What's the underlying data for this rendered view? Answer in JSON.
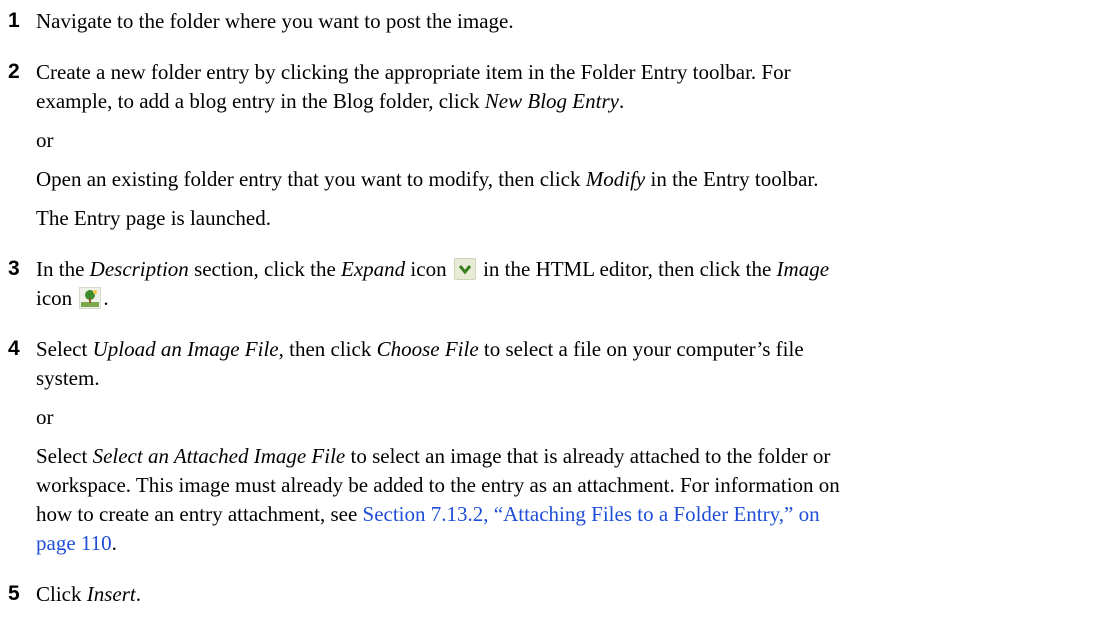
{
  "steps": [
    {
      "number": "1",
      "text": "Navigate to the folder where you want to post the image."
    },
    {
      "number": "2",
      "text_a": "Create a new folder entry by clicking the appropriate item in the Folder Entry toolbar. For",
      "text_b": "example, to add a blog entry in the Blog folder, click ",
      "em_new_blog": "New Blog Entry",
      "text_b_end": ".",
      "or": "or",
      "text_c1": "Open an existing folder entry that you want to modify, then click ",
      "em_modify": "Modify",
      "text_c2": " in the Entry toolbar.",
      "text_d": "The Entry page is launched."
    },
    {
      "number": "3",
      "p1": "In the ",
      "em_description": "Description",
      "p2": " section, click the ",
      "em_expand": "Expand",
      "p3": " icon ",
      "p4": " in the HTML editor, then click the ",
      "em_image": "Image",
      "p5": "icon ",
      "p6": ".",
      "expand_icon": "chevron-down-icon",
      "image_icon": "tree-image-icon"
    },
    {
      "number": "4",
      "p1": "Select ",
      "em_upload": "Upload an Image File",
      "p2": ", then click ",
      "em_choose": "Choose File",
      "p3": " to select a file on your computer’s file",
      "p4": "system.",
      "or": "or",
      "q1": "Select ",
      "em_select_attached": "Select an Attached Image File",
      "q2": " to select an image that is already attached to the folder or",
      "q3": "workspace. This image must already be added to the entry as an attachment. For information on",
      "q4": "how to create an entry attachment, see ",
      "link_a": "Section 7.13.2, “Attaching Files to a Folder Entry,” on",
      "link_b": "page 110",
      "q5": "."
    },
    {
      "number": "5",
      "p1": "Click ",
      "em_insert": "Insert",
      "p2": "."
    }
  ],
  "colors": {
    "link": "#1f4fd8",
    "expand_icon_bg": "#e8ecd7",
    "expand_chevron": "#3a7f1e"
  }
}
